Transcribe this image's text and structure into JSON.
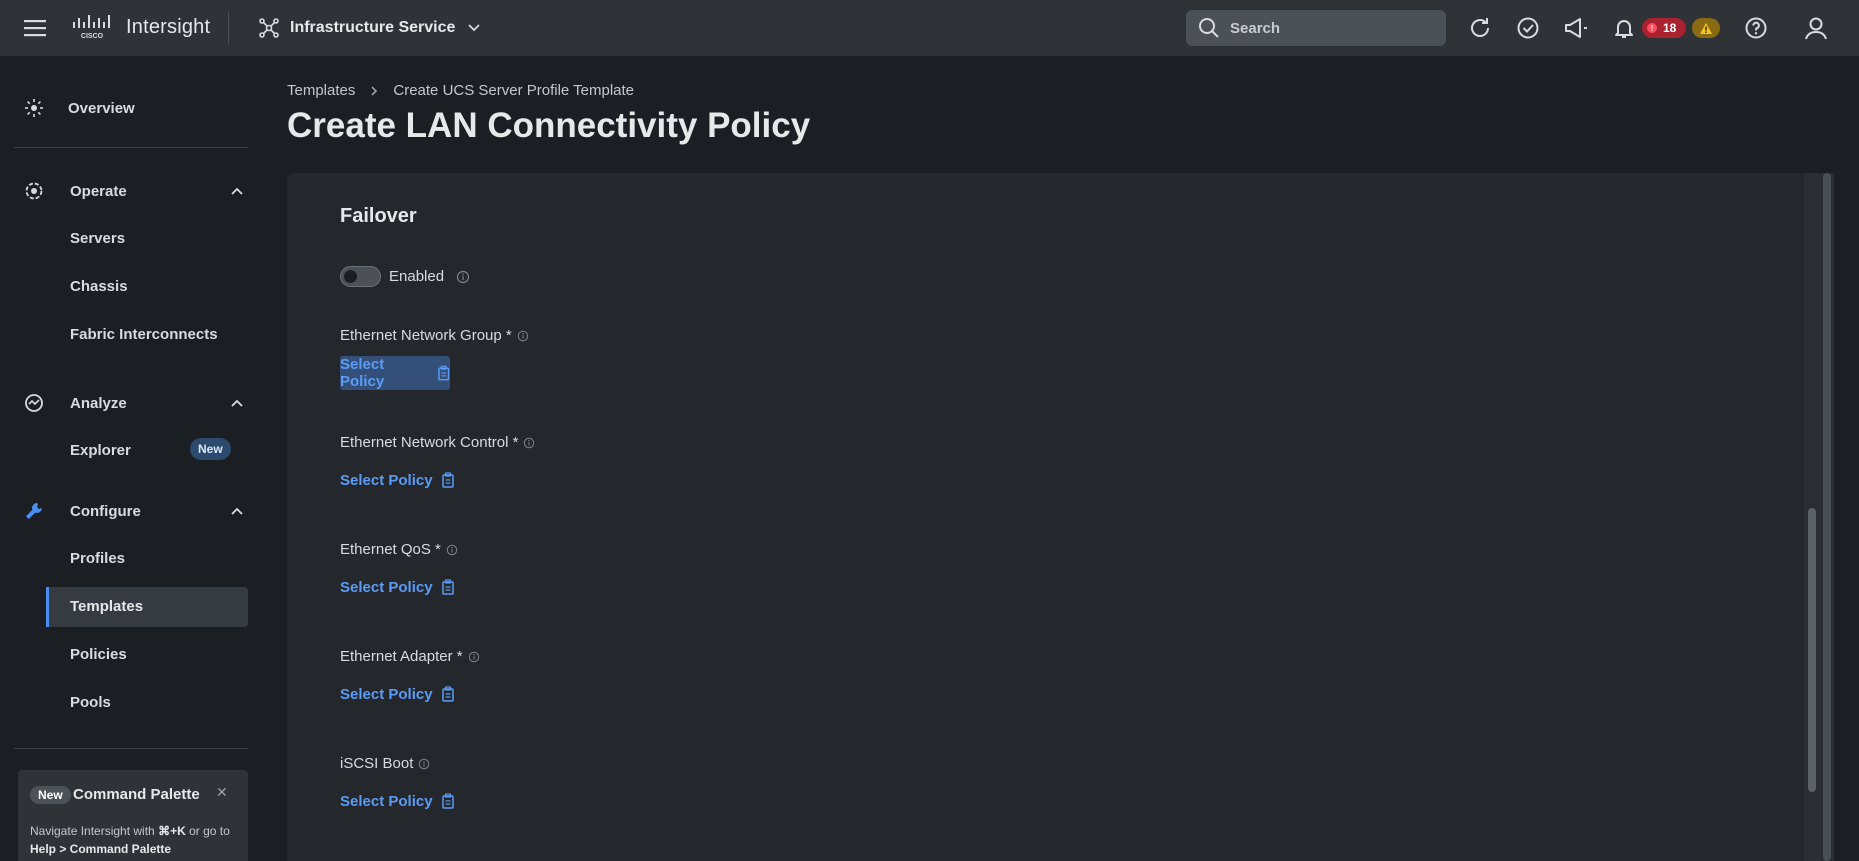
{
  "header": {
    "app_name": "Intersight",
    "service": "Infrastructure Service",
    "search_placeholder": "Search",
    "alarm_count": "18"
  },
  "sidebar": {
    "overview": "Overview",
    "operate": {
      "label": "Operate",
      "items": [
        "Servers",
        "Chassis",
        "Fabric Interconnects"
      ]
    },
    "analyze": {
      "label": "Analyze",
      "items": [
        "Explorer"
      ],
      "new_badge": "New"
    },
    "configure": {
      "label": "Configure",
      "items": [
        "Profiles",
        "Templates",
        "Policies",
        "Pools"
      ],
      "active": "Templates"
    },
    "command_palette": {
      "badge": "New",
      "title": "Command Palette",
      "desc_prefix": "Navigate Intersight with ",
      "shortcut": "⌘+K",
      "desc_mid": " or go to ",
      "path": "Help > Command Palette"
    }
  },
  "breadcrumb": [
    "Templates",
    "Create UCS Server Profile Template"
  ],
  "page_title": "Create LAN Connectivity Policy",
  "form": {
    "section_title": "Failover",
    "toggle_label": "Enabled",
    "toggle_on": false,
    "select_label": "Select Policy",
    "fields": [
      {
        "label": "Ethernet Network Group *"
      },
      {
        "label": "Ethernet Network Control *"
      },
      {
        "label": "Ethernet QoS *"
      },
      {
        "label": "Ethernet Adapter *"
      },
      {
        "label": "iSCSI Boot"
      }
    ]
  },
  "colors": {
    "accent": "#5a9cf5",
    "topbar": "#2f3338",
    "background": "#1b1f23",
    "panel": "#24282c",
    "alarm_red": "#a8232f",
    "warning_yellow": "#8a6a12"
  }
}
